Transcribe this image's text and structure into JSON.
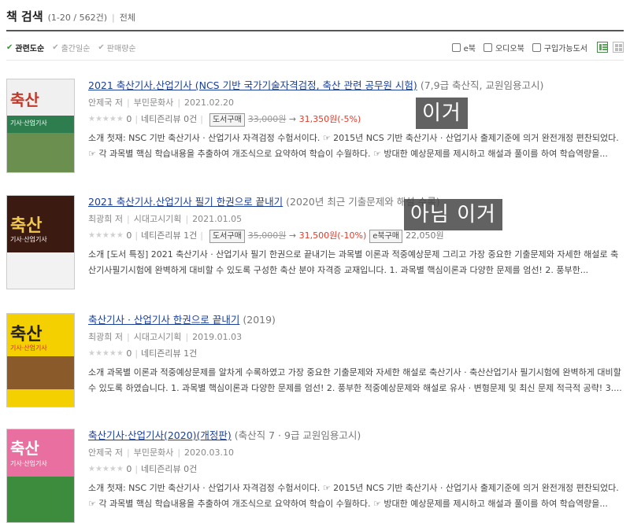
{
  "header": {
    "title": "책 검색",
    "count": "(1-20 / 562건)",
    "sep": "|",
    "scope": "전체"
  },
  "sort_options": [
    {
      "label": "관련도순",
      "active": true
    },
    {
      "label": "출간일순",
      "active": false
    },
    {
      "label": "판매량순",
      "active": false
    }
  ],
  "filters": {
    "ebook": "e북",
    "audiobook": "오디오북",
    "available": "구입가능도서"
  },
  "colors": {
    "link": "#1a3f9c",
    "price": "#e23c2c",
    "check": "#2a9a2a"
  },
  "books": [
    {
      "title": "2021 축산기사.산업기사 (NCS 기반 국가기술자격검정, 축산 관련 공무원 시험)",
      "subtitle": "(7,9급 축산직, 교원임용고시)",
      "author": "안제국 저",
      "publisher": "부민문화사",
      "date": "2021.02.20",
      "rating": "0",
      "review": "네티즌리뷰 0건",
      "buy_label": "도서구매",
      "orig_price": "33,000원",
      "arrow": "→",
      "price": "31,350원(-5%)",
      "ebook_label": "",
      "ebook_price": "",
      "desc": "소개  첫재: NSC 기반 축산기사 · 산업기사 자격검정 수험서이다. ☞ 2015년 NCS 기반 축산기사 · 산업기사 출제기준에 의거 완전개정 편찬되었다. ☞ 각 과목별 핵심 학습내용을 추출하여 개조식으로 요약하여 학습이 수월하다. ☞ 방대한 예상문제를 제시하고 해설과 풀이를 하여 학습역량을...",
      "cover": {
        "big": "축산",
        "mid": "기사·산업기사",
        "bg": "#2e7d4f",
        "band": "#f0f0f0",
        "accent": "#c0392b"
      }
    },
    {
      "title": "2021 축산기사.산업기사 필기 한권으로 끝내기",
      "subtitle": "(2020년 최근 기출문제와 해설 수록)",
      "author": "최광희 저",
      "publisher": "시대고시기획",
      "date": "2021.01.05",
      "rating": "0",
      "review": "네티즌리뷰 1건",
      "buy_label": "도서구매",
      "orig_price": "35,000원",
      "arrow": "→",
      "price": "31,500원(-10%)",
      "ebook_label": "e북구매",
      "ebook_price": "22,050원",
      "desc": "소개  [도서 특징] 2021 축산기사 · 산업기사 필기 한권으로 끝내기는 과목별 이론과 적중예상문제 그리고 가장 중요한 기출문제와 자세한 해설로 축산기사필기시험에 완벽하게 대비할 수 있도록 구성한 축산 분야 자격증 교재입니다. 1. 과목별 핵심이론과 다양한 문제를 엄선! 2. 풍부한...",
      "cover": {
        "big": "축산",
        "mid": "기사·산업기사",
        "bg": "#3b1a12",
        "band": "#f2f2f2",
        "accent": "#f2c94c"
      }
    },
    {
      "title": "축산기사 · 산업기사 한권으로 끝내기",
      "subtitle": "(2019)",
      "author": "최광희 저",
      "publisher": "시대고시기획",
      "date": "2019.01.03",
      "rating": "0",
      "review": "네티즌리뷰 1건",
      "buy_label": "",
      "orig_price": "",
      "arrow": "",
      "price": "",
      "ebook_label": "",
      "ebook_price": "",
      "desc": "소개  과목별 이론과 적중예상문제를 알차게 수록하였고 가장 중요한 기출문제와 자세한 해설로 축산기사 · 축산산업기사 필기시험에 완벽하게 대비할 수 있도록 하였습니다. 1. 과목별 핵심이론과 다양한 문제를 엄선! 2. 풍부한 적중예상문제와 해설로 유사 · 변형문제 및 최신 문제 적극적 공략! 3....",
      "cover": {
        "big": "축산",
        "mid": "기사·산업기사",
        "bg": "#f5d000",
        "band": "#8b5a2b",
        "accent": "#d81b60"
      }
    },
    {
      "title": "축산기사·산업기사(2020)(개정판)",
      "subtitle": "(축산직 7 · 9급 교원임용고시)",
      "author": "안제국 저",
      "publisher": "부민문화사",
      "date": "2020.03.10",
      "rating": "0",
      "review": "네티즌리뷰 0건",
      "buy_label": "",
      "orig_price": "",
      "arrow": "",
      "price": "",
      "ebook_label": "",
      "ebook_price": "",
      "desc": "소개  첫재: NSC 기반 축산기사 · 산업기사 자격검정 수험서이다. ☞ 2015년 NCS 기반 축산기사 · 산업기사 출제기준에 의거 완전개정 편찬되었다. ☞ 각 과목별 핵심 학습내용을 추출하여 개조식으로 요약하여 학습이 수월하다. ☞ 방대한 예상문제를 제시하고 해설과 풀이를 하여 학습역량을...",
      "cover": {
        "big": "축산",
        "mid": "기사·산업기사",
        "bg": "#e96fa0",
        "band": "#3d8b3d",
        "accent": "#fff"
      }
    }
  ],
  "annotations": {
    "first": "이거",
    "second": "아님 이거"
  }
}
